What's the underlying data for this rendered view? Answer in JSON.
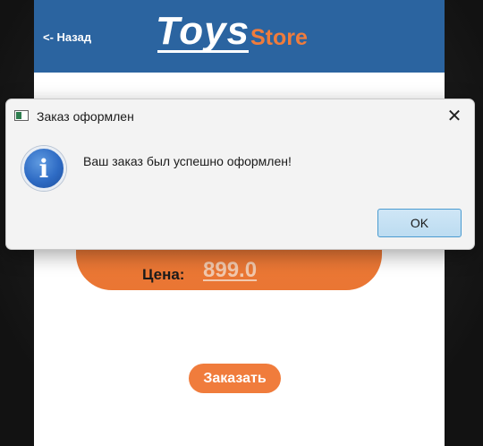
{
  "app": {
    "back_label": "<- Назад",
    "logo": {
      "toys": "Toys",
      "store": "Store"
    },
    "price_label": "Цена:",
    "price_value": "899.0",
    "order_button": "Заказать"
  },
  "dialog": {
    "title": "Заказ оформлен",
    "message": "Ваш заказ был успешно оформлен!",
    "ok_label": "OK",
    "close_symbol": "✕",
    "info_symbol": "i"
  },
  "colors": {
    "header": "#2b64a0",
    "accent": "#f07c3c",
    "button_blue": "#4b9bd0"
  }
}
